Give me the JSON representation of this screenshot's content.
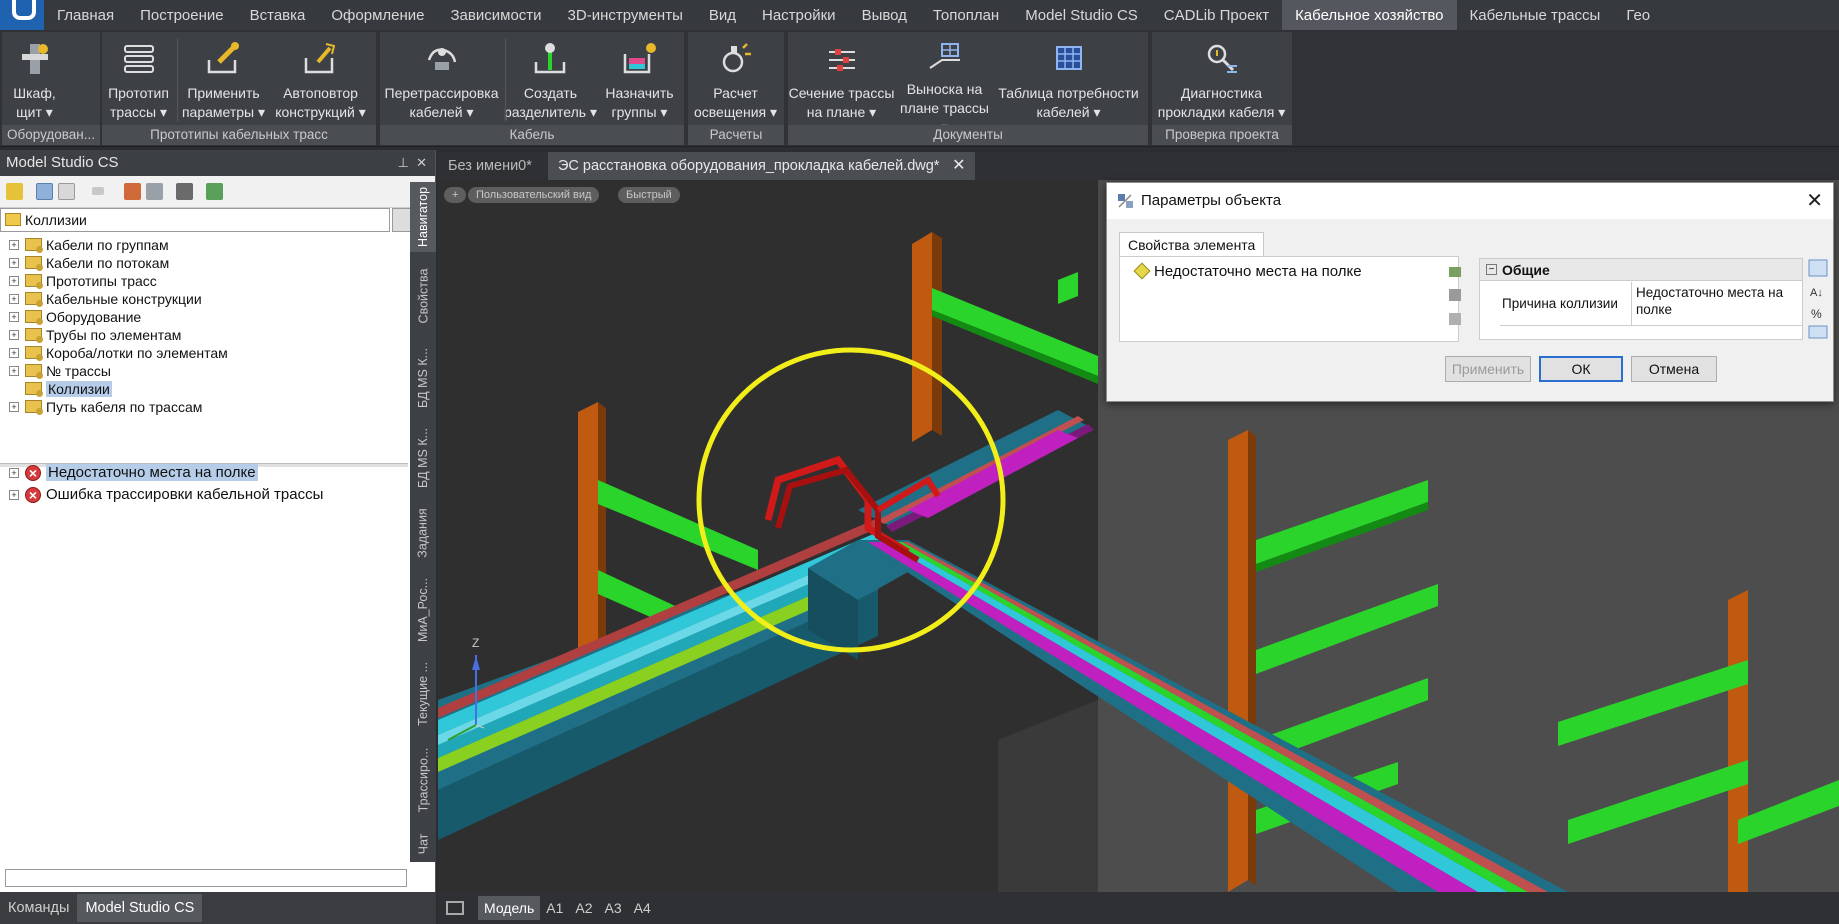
{
  "menu": [
    "Главная",
    "Построение",
    "Вставка",
    "Оформление",
    "Зависимости",
    "3D-инструменты",
    "Вид",
    "Настройки",
    "Вывод",
    "Топоплан",
    "Model Studio CS",
    "CADLib Проект",
    "Кабельное хозяйство",
    "Кабельные трассы",
    "Гео"
  ],
  "ribbon": {
    "groups": [
      {
        "title": "Оборудован...",
        "buttons": [
          "Шкаф,\nщит ▾"
        ]
      },
      {
        "title": "Прототипы кабельных трасс",
        "buttons": [
          "Прототип\nтрассы ▾",
          "Применить\nпараметры ▾",
          "Автоповтор\nконструкций ▾"
        ]
      },
      {
        "title": "Кабель",
        "buttons": [
          "Перетрассировка\nкабелей ▾",
          "Создать\nразделитель ▾",
          "Назначить\nгруппы ▾"
        ]
      },
      {
        "title": "Расчеты",
        "buttons": [
          "Расчет\nосвещения ▾"
        ]
      },
      {
        "title": "Документы",
        "buttons": [
          "Сечение трассы\nна плане ▾",
          "Выноска на\nплане трассы ▾",
          "Таблица потребности\nкабелей ▾"
        ]
      },
      {
        "title": "Проверка проекта",
        "buttons": [
          "Диагностика\nпрокладки кабеля ▾"
        ]
      }
    ]
  },
  "left_panel": {
    "title": "Model Studio CS",
    "combo_value": "Коллизии",
    "vertical_tabs": [
      "Навигатор",
      "Свойства",
      "БД MS К...",
      "БД MS К...",
      "Задания",
      "МиА_Рос...",
      "Текущие ...",
      "Трассиро...",
      "Чат"
    ],
    "tree_items": [
      "Кабели по группам",
      "Кабели по потокам",
      "Прототипы трасс",
      "Кабельные конструкции",
      "Оборудование",
      "Трубы по элементам",
      "Короба/лотки по элементам",
      "№ трассы",
      "Коллизии",
      "Путь кабеля по трассам"
    ],
    "collisions": [
      "Недостаточно места на полке",
      "Ошибка трассировки кабельной трассы"
    ]
  },
  "bottom_left_tabs": [
    "Команды",
    "Model Studio CS"
  ],
  "doc_tabs": [
    "Без имени0*",
    "ЭС расстановка оборудования_прокладка кабелей.dwg*"
  ],
  "doc_close": "✕",
  "viewport_pills": [
    "+",
    "Пользовательский вид",
    "Быстрый"
  ],
  "axis_label": "Z",
  "model_tabs": [
    "Модель",
    "A1",
    "A2",
    "A3",
    "A4"
  ],
  "dialog": {
    "title": "Параметры объекта",
    "close": "✕",
    "tab": "Свойства элемента",
    "element": "Недостаточно места на полке",
    "group": "Общие",
    "collapse": "−",
    "prop_key": "Причина коллизии",
    "prop_value": "Недостаточно места на полке",
    "apply": "Применить",
    "ok": "ОК",
    "cancel": "Отмена"
  },
  "colors": {
    "accent": "#1e62b0",
    "highlight_circle": "#f2ee1a",
    "tray": "#1f6f86",
    "cable_cyan": "#30c8d8",
    "cable_magenta": "#c020c0",
    "cable_red": "#d01a1a",
    "bracket": "#2ad42a",
    "post": "#c05a10"
  }
}
